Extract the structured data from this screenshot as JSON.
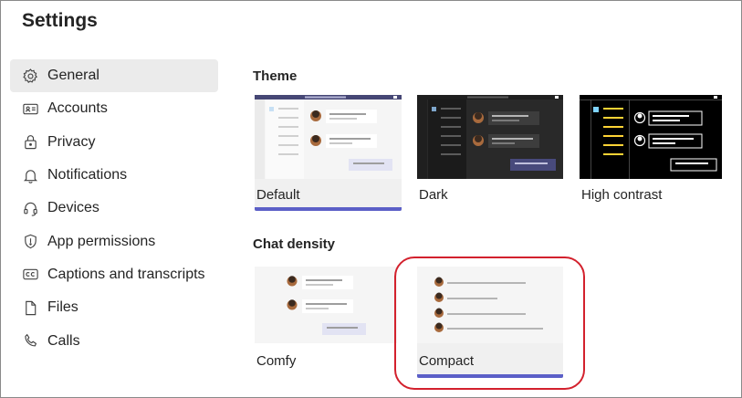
{
  "window": {
    "title": "Settings"
  },
  "sidebar": {
    "items": [
      {
        "label": "General",
        "icon": "gear-icon",
        "active": true
      },
      {
        "label": "Accounts",
        "icon": "id-card-icon",
        "active": false
      },
      {
        "label": "Privacy",
        "icon": "lock-icon",
        "active": false
      },
      {
        "label": "Notifications",
        "icon": "bell-icon",
        "active": false
      },
      {
        "label": "Devices",
        "icon": "headset-icon",
        "active": false
      },
      {
        "label": "App permissions",
        "icon": "shield-icon",
        "active": false
      },
      {
        "label": "Captions and transcripts",
        "icon": "cc-icon",
        "active": false
      },
      {
        "label": "Files",
        "icon": "file-icon",
        "active": false
      },
      {
        "label": "Calls",
        "icon": "phone-icon",
        "active": false
      }
    ]
  },
  "theme": {
    "heading": "Theme",
    "options": [
      {
        "label": "Default",
        "selected": true
      },
      {
        "label": "Dark",
        "selected": false
      },
      {
        "label": "High contrast",
        "selected": false
      }
    ]
  },
  "density": {
    "heading": "Chat density",
    "options": [
      {
        "label": "Comfy",
        "selected": false
      },
      {
        "label": "Compact",
        "selected": true
      }
    ]
  },
  "colors": {
    "accent": "#5b5fc7",
    "highlight_ring": "#d3212d",
    "dark_theme_bg": "#292929",
    "high_contrast_bg": "#000000",
    "high_contrast_yellow": "#ffd335"
  }
}
